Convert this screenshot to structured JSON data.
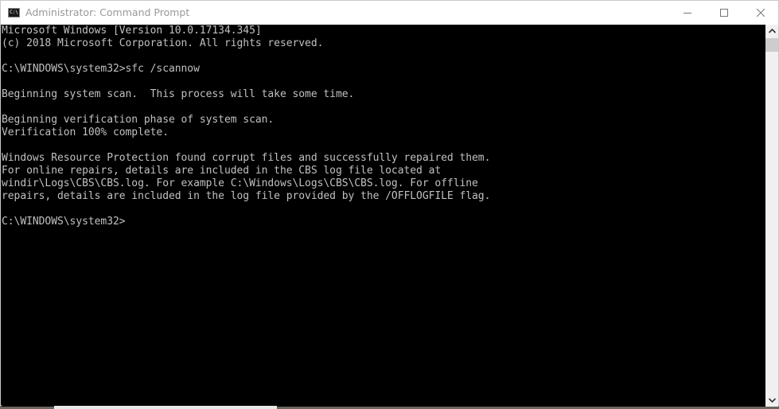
{
  "window": {
    "title": "Administrator: Command Prompt",
    "icon": "cmd-icon",
    "controls": {
      "minimize": "minimize-icon",
      "maximize": "maximize-icon",
      "close": "close-icon"
    }
  },
  "console": {
    "lines": [
      "Microsoft Windows [Version 10.0.17134.345]",
      "(c) 2018 Microsoft Corporation. All rights reserved.",
      "",
      "C:\\WINDOWS\\system32>sfc /scannow",
      "",
      "Beginning system scan.  This process will take some time.",
      "",
      "Beginning verification phase of system scan.",
      "Verification 100% complete.",
      "",
      "Windows Resource Protection found corrupt files and successfully repaired them.",
      "For online repairs, details are included in the CBS log file located at",
      "windir\\Logs\\CBS\\CBS.log. For example C:\\Windows\\Logs\\CBS\\CBS.log. For offline",
      "repairs, details are included in the log file provided by the /OFFLOGFILE flag.",
      "",
      "C:\\WINDOWS\\system32>"
    ],
    "prompt": "C:\\WINDOWS\\system32>",
    "colors": {
      "background": "#000000",
      "foreground": "#c0c0c0"
    }
  },
  "scrollbar": {
    "up": "chevron-up-icon",
    "down": "chevron-down-icon"
  }
}
